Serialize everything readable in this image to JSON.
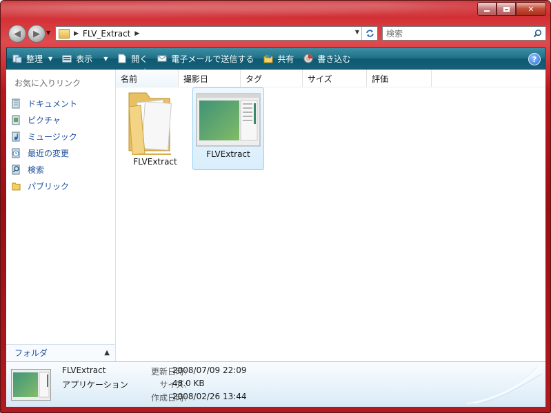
{
  "address": {
    "path": "FLV_Extract"
  },
  "search": {
    "placeholder": "検索"
  },
  "toolbar": {
    "organize": "整理",
    "views": "表示",
    "open": "開く",
    "email": "電子メールで送信する",
    "share": "共有",
    "burn": "書き込む",
    "help": "?"
  },
  "sidebar": {
    "title": "お気に入りリンク",
    "items": [
      {
        "label": "ドキュメント",
        "icon": "documents-icon"
      },
      {
        "label": "ピクチャ",
        "icon": "pictures-icon"
      },
      {
        "label": "ミュージック",
        "icon": "music-icon"
      },
      {
        "label": "最近の変更",
        "icon": "recent-changes-icon"
      },
      {
        "label": "検索",
        "icon": "searches-icon"
      },
      {
        "label": "パブリック",
        "icon": "public-folder-icon"
      }
    ],
    "folders_label": "フォルダ"
  },
  "columns": [
    "名前",
    "撮影日",
    "タグ",
    "サイズ",
    "評価"
  ],
  "files": [
    {
      "name": "FLVExtract",
      "type": "folder"
    },
    {
      "name": "FLVExtract",
      "type": "application",
      "selected": true
    }
  ],
  "details": {
    "name": "FLVExtract",
    "type": "アプリケーション",
    "labels": [
      "更新日時:",
      "サイズ:",
      "作成日時:"
    ],
    "values": [
      "2008/07/09 22:09",
      "48.0 KB",
      "2008/02/26 13:44"
    ]
  },
  "colors": {
    "toolbar": "#1f6f86",
    "link": "#1e4f9c",
    "frame": "#b8161c"
  }
}
